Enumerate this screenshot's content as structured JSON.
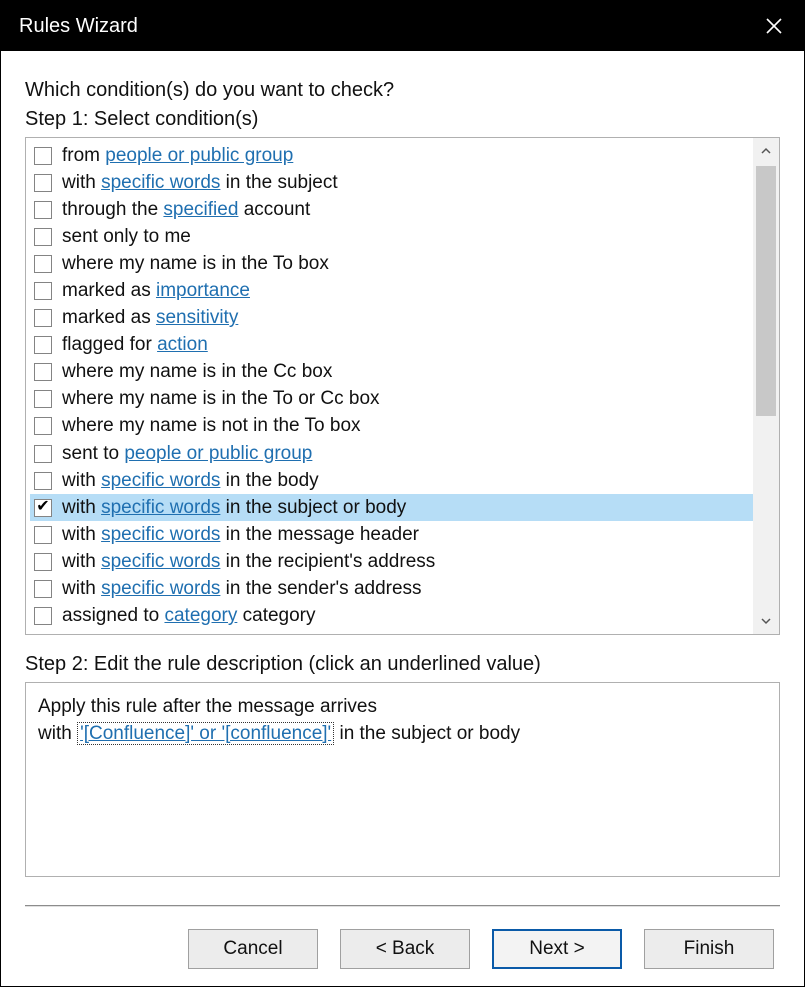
{
  "window": {
    "title": "Rules Wizard",
    "close_label": "Close"
  },
  "prompt": "Which condition(s) do you want to check?",
  "step1_label": "Step 1: Select condition(s)",
  "conditions": [
    {
      "checked": false,
      "selected": false,
      "parts": [
        {
          "t": "from "
        },
        {
          "t": "people or public group",
          "link": true
        }
      ]
    },
    {
      "checked": false,
      "selected": false,
      "parts": [
        {
          "t": "with "
        },
        {
          "t": "specific words",
          "link": true
        },
        {
          "t": " in the subject"
        }
      ]
    },
    {
      "checked": false,
      "selected": false,
      "parts": [
        {
          "t": "through the "
        },
        {
          "t": "specified",
          "link": true
        },
        {
          "t": " account"
        }
      ]
    },
    {
      "checked": false,
      "selected": false,
      "parts": [
        {
          "t": "sent only to me"
        }
      ]
    },
    {
      "checked": false,
      "selected": false,
      "parts": [
        {
          "t": "where my name is in the To box"
        }
      ]
    },
    {
      "checked": false,
      "selected": false,
      "parts": [
        {
          "t": "marked as "
        },
        {
          "t": "importance",
          "link": true
        }
      ]
    },
    {
      "checked": false,
      "selected": false,
      "parts": [
        {
          "t": "marked as "
        },
        {
          "t": "sensitivity",
          "link": true
        }
      ]
    },
    {
      "checked": false,
      "selected": false,
      "parts": [
        {
          "t": "flagged for "
        },
        {
          "t": "action",
          "link": true
        }
      ]
    },
    {
      "checked": false,
      "selected": false,
      "parts": [
        {
          "t": "where my name is in the Cc box"
        }
      ]
    },
    {
      "checked": false,
      "selected": false,
      "parts": [
        {
          "t": "where my name is in the To or Cc box"
        }
      ]
    },
    {
      "checked": false,
      "selected": false,
      "parts": [
        {
          "t": "where my name is not in the To box"
        }
      ]
    },
    {
      "checked": false,
      "selected": false,
      "parts": [
        {
          "t": "sent to "
        },
        {
          "t": "people or public group",
          "link": true
        }
      ]
    },
    {
      "checked": false,
      "selected": false,
      "parts": [
        {
          "t": "with "
        },
        {
          "t": "specific words",
          "link": true
        },
        {
          "t": " in the body"
        }
      ]
    },
    {
      "checked": true,
      "selected": true,
      "parts": [
        {
          "t": "with "
        },
        {
          "t": "specific words",
          "link": true
        },
        {
          "t": " in the subject or body"
        }
      ]
    },
    {
      "checked": false,
      "selected": false,
      "parts": [
        {
          "t": "with "
        },
        {
          "t": "specific words",
          "link": true
        },
        {
          "t": " in the message header"
        }
      ]
    },
    {
      "checked": false,
      "selected": false,
      "parts": [
        {
          "t": "with "
        },
        {
          "t": "specific words",
          "link": true
        },
        {
          "t": " in the recipient's address"
        }
      ]
    },
    {
      "checked": false,
      "selected": false,
      "parts": [
        {
          "t": "with "
        },
        {
          "t": "specific words",
          "link": true
        },
        {
          "t": " in the sender's address"
        }
      ]
    },
    {
      "checked": false,
      "selected": false,
      "parts": [
        {
          "t": "assigned to "
        },
        {
          "t": "category",
          "link": true
        },
        {
          "t": " category"
        }
      ]
    }
  ],
  "step2_label": "Step 2: Edit the rule description (click an underlined value)",
  "description": {
    "line1": "Apply this rule after the message arrives",
    "line2_prefix": "with ",
    "line2_value": "'[Confluence]' or '[confluence]'",
    "line2_suffix": " in the subject or body"
  },
  "buttons": {
    "cancel": "Cancel",
    "back": "< Back",
    "next": "Next >",
    "finish": "Finish"
  }
}
